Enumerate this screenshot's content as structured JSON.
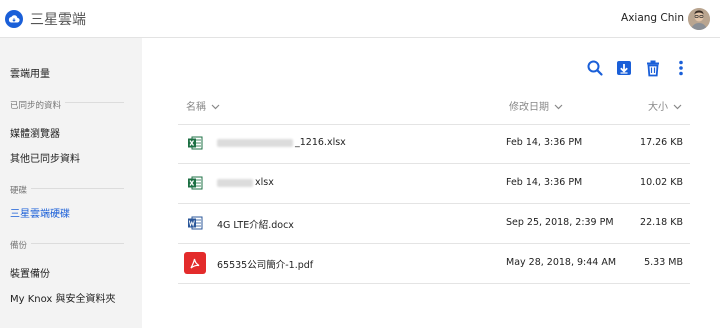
{
  "app": {
    "title": "三星雲端",
    "user_name": "Axiang Chin",
    "accent_color": "#1a5fd8"
  },
  "sidebar": {
    "items": [
      {
        "label": "雲端用量"
      },
      {
        "section": "已同步的資料"
      },
      {
        "label": "媒體瀏覽器"
      },
      {
        "label": "其他已同步資料"
      },
      {
        "section": "硬碟"
      },
      {
        "label": "三星雲端硬碟",
        "active": true
      },
      {
        "section": "備份"
      },
      {
        "label": "裝置備份"
      },
      {
        "label": "My Knox 與安全資料夾"
      }
    ]
  },
  "toolbar": {
    "icons": [
      "search-icon",
      "download-icon",
      "trash-icon",
      "more-vert-icon"
    ]
  },
  "table": {
    "headers": {
      "name": "名稱",
      "modified": "修改日期",
      "size": "大小"
    },
    "rows": [
      {
        "type": "excel",
        "name_visible": "_1216.xlsx",
        "name_redacted": true,
        "date": "Feb 14, 3:36 PM",
        "size": "17.26 KB"
      },
      {
        "type": "excel",
        "name_visible": "xlsx",
        "name_redacted": true,
        "date": "Feb 14, 3:36 PM",
        "size": "10.02 KB"
      },
      {
        "type": "word",
        "name_visible": "4G LTE介紹.docx",
        "name_redacted": false,
        "date": "Sep 25, 2018, 2:39 PM",
        "size": "22.18 KB"
      },
      {
        "type": "pdf",
        "name_visible": "65535公司簡介-1.pdf",
        "name_redacted": false,
        "date": "May 28, 2018, 9:44 AM",
        "size": "5.33 MB"
      }
    ]
  }
}
